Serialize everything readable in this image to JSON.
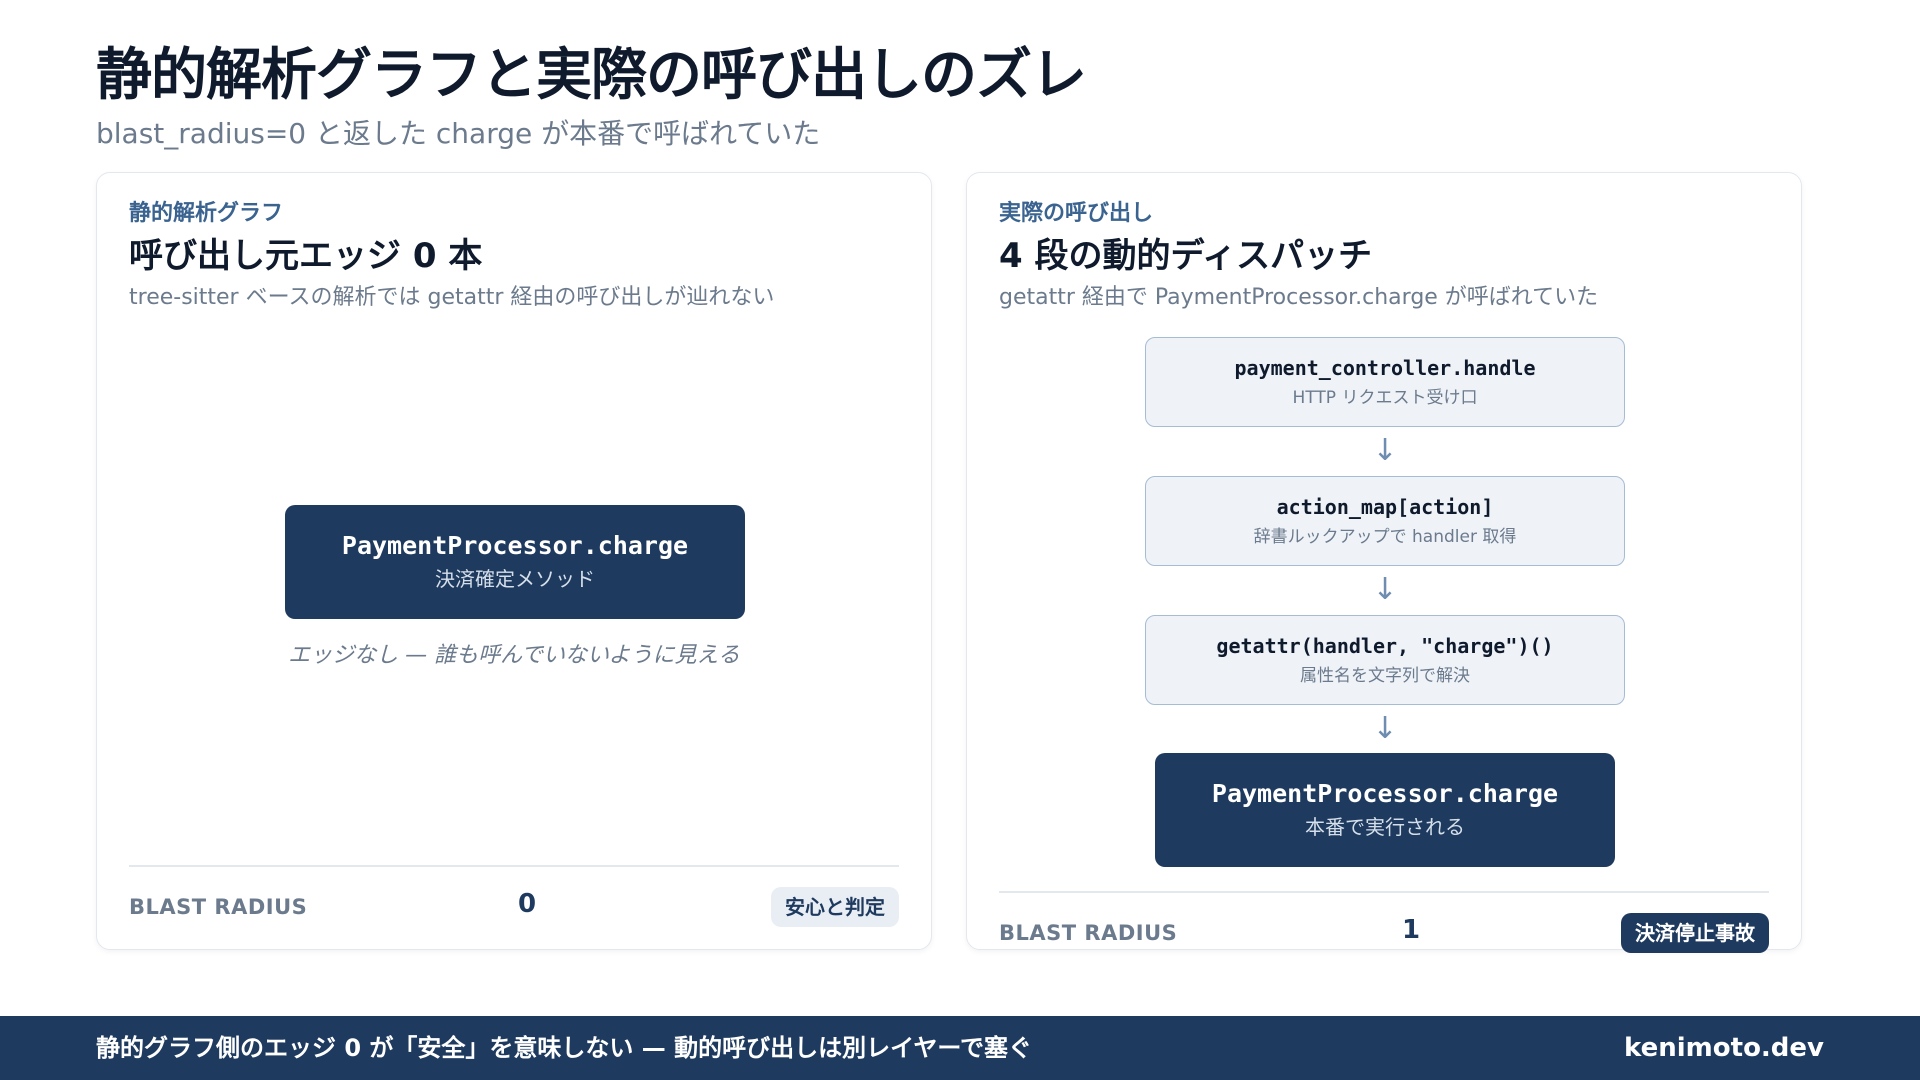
{
  "header": {
    "title": "静的解析グラフと実際の呼び出しのズレ",
    "subtitle": "blast_radius=0 と返した charge が本番で呼ばれていた"
  },
  "left_card": {
    "eyebrow": "静的解析グラフ",
    "title": "呼び出し元エッジ 0 本",
    "description": "tree-sitter ベースの解析では getattr 経由の呼び出しが辿れない",
    "node": {
      "title": "PaymentProcessor.charge",
      "subtitle": "決済確定メソッド"
    },
    "note": "エッジなし — 誰も呼んでいないように見える",
    "blast_label": "BLAST RADIUS",
    "blast_value": "0",
    "badge": "安心と判定"
  },
  "right_card": {
    "eyebrow": "実際の呼び出し",
    "title": "4 段の動的ディスパッチ",
    "description": "getattr 経由で PaymentProcessor.charge が呼ばれていた",
    "flow": [
      {
        "title": "payment_controller.handle",
        "subtitle": "HTTP リクエスト受け口"
      },
      {
        "title": "action_map[action]",
        "subtitle": "辞書ルックアップで handler 取得"
      },
      {
        "title": "getattr(handler, \"charge\")()",
        "subtitle": "属性名を文字列で解決"
      }
    ],
    "arrow_glyph": "↓",
    "final_node": {
      "title": "PaymentProcessor.charge",
      "subtitle": "本番で実行される"
    },
    "blast_label": "BLAST RADIUS",
    "blast_value": "1",
    "badge": "決済停止事故"
  },
  "footer": {
    "text": "静的グラフ側のエッジ 0 が「安全」を意味しない — 動的呼び出しは別レイヤーで塞ぐ",
    "brand": "kenimoto.dev"
  },
  "colors": {
    "navy": "#1f3a5f",
    "accent_blue": "#3a6390",
    "muted_text": "#6b7a8c",
    "flow_node_bg": "#eff3f8",
    "flow_node_border": "#a6bcd4"
  }
}
